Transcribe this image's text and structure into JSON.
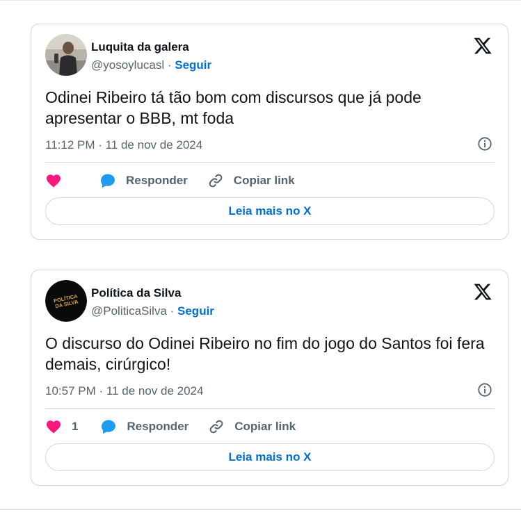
{
  "tweets": [
    {
      "display_name": "Luquita da galera",
      "handle": "@yosoylucasl",
      "separator": " · ",
      "follow_label": "Seguir",
      "text": "Odinei Ribeiro tá tão bom com discursos que já pode apresentar o BBB, mt foda",
      "timestamp": "11:12 PM · 11 de nov de 2024",
      "like_count": "",
      "reply_label": "Responder",
      "copy_link_label": "Copiar link",
      "read_more_label": "Leia mais no X",
      "avatar_icon": "user-photo-avatar"
    },
    {
      "display_name": "Política da Silva",
      "handle": "@PoliticaSilva",
      "separator": " · ",
      "follow_label": "Seguir",
      "text": "O discurso do Odinei Ribeiro no fim do jogo do Santos foi fera demais, cirúrgico!",
      "timestamp": "10:57 PM · 11 de nov de 2024",
      "like_count": "1",
      "reply_label": "Responder",
      "copy_link_label": "Copiar link",
      "read_more_label": "Leia mais no X",
      "avatar_logo_text": "POLÍTICA DA SILVA"
    }
  ],
  "colors": {
    "like": "#f91880",
    "reply": "#1d9bf0",
    "link": "#006fd6",
    "muted": "#536471",
    "border": "#cfd9de"
  }
}
